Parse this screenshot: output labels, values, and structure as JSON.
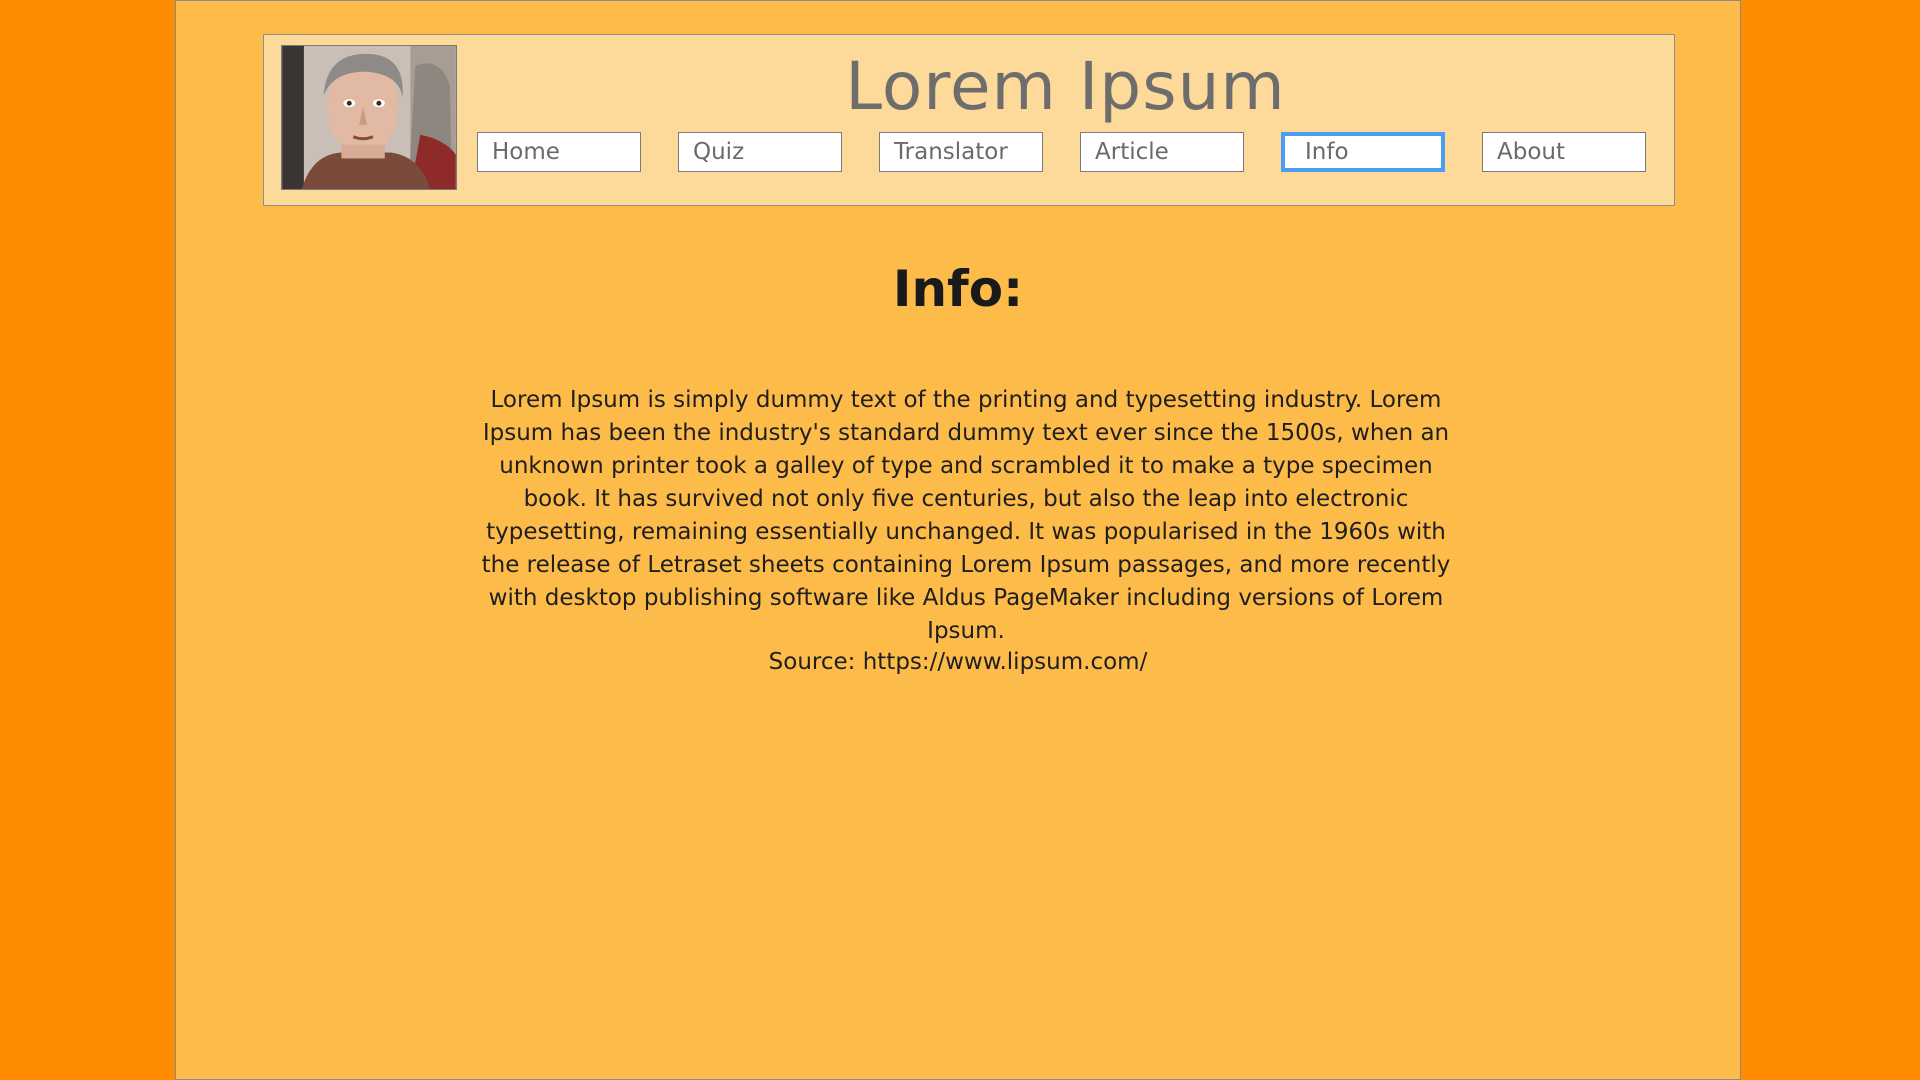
{
  "header": {
    "site_title": "Lorem Ipsum",
    "nav": [
      {
        "label": "Home",
        "active": false
      },
      {
        "label": "Quiz",
        "active": false
      },
      {
        "label": "Translator",
        "active": false
      },
      {
        "label": "Article",
        "active": false
      },
      {
        "label": "Info",
        "active": true
      },
      {
        "label": "About",
        "active": false
      }
    ]
  },
  "main": {
    "title": "Info:",
    "body": "Lorem Ipsum is simply dummy text of the printing and typesetting industry. Lorem Ipsum has been the industry's standard dummy text ever since the 1500s, when an unknown printer took a galley of type and scrambled it to make a type specimen book. It has survived not only five centuries, but also the leap into electronic typesetting, remaining essentially unchanged. It was popularised in the 1960s with the release of Letraset sheets containing Lorem Ipsum passages, and more recently with desktop publishing software like Aldus PageMaker including versions of Lorem Ipsum.",
    "source": "Source: https://www.lipsum.com/"
  },
  "colors": {
    "outer_background": "#FF8C00",
    "page_background": "#FDBB4A",
    "header_background": "#FEDA9A",
    "active_border": "#4A9FF5"
  }
}
